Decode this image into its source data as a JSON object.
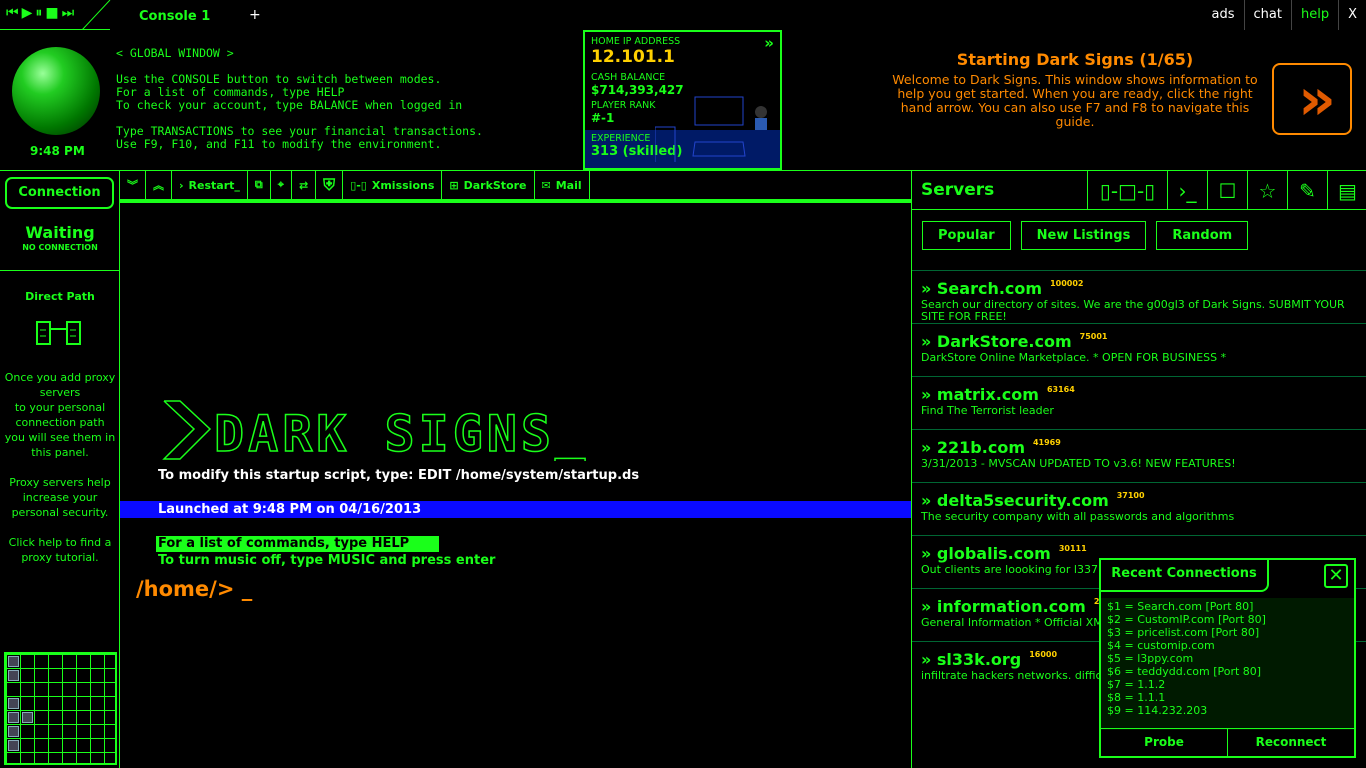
{
  "topbar": {
    "media_icons": [
      "skip-back-icon",
      "play-icon",
      "pause-icon",
      "stop-icon",
      "skip-forward-icon"
    ],
    "tab": "Console 1",
    "add_tab": "+",
    "links": [
      "ads",
      "chat",
      "help",
      "X"
    ]
  },
  "header": {
    "clock": "9:48 PM",
    "global_window": "< GLOBAL WINDOW >\n\nUse the CONSOLE button to switch between modes.\nFor a list of commands, type HELP\nTo check your account, type BALANCE when logged in\n\nType TRANSACTIONS to see your financial transactions.\nUse F9, F10, and F11 to modify the environment.",
    "stats": {
      "ip_label": "HOME IP ADDRESS",
      "ip": "12.101.1",
      "cash_label": "CASH BALANCE",
      "cash": "$714,393,427",
      "rank_label": "PLAYER RANK",
      "rank": "#-1",
      "exp_label": "EXPERIENCE",
      "exp": "313 (skilled)"
    },
    "guide": {
      "title": "Starting Dark Signs (1/65)",
      "text": "Welcome to Dark Signs. This window shows information to help you get started. When you are ready, click the right hand arrow. You can also use F7 and F8 to navigate this guide."
    }
  },
  "left": {
    "connection": "Connection",
    "status": "Waiting",
    "substatus": "NO CONNECTION",
    "path_title": "Direct Path",
    "help": "Once you add proxy servers\nto your personal connection path you will see them in this panel.\n\nProxy servers help increase your personal security.\n\nClick help to find a proxy tutorial."
  },
  "toolbar": {
    "restart": "Restart_",
    "xmissions": "Xmissions",
    "darkstore": "DarkStore",
    "mail": "Mail"
  },
  "console": {
    "logo": "DARK SIGNS_",
    "modify": "To modify this startup script, type: EDIT /home/system/startup.ds",
    "launched": "Launched at 9:48 PM on 04/16/2013",
    "help": "For a list of commands, type HELP",
    "music": "To turn music off, type MUSIC and press enter",
    "prompt": "/home/> _"
  },
  "servers": {
    "title": "Servers",
    "filters": [
      "Popular",
      "New Listings",
      "Random"
    ],
    "items": [
      {
        "name": "Search.com",
        "hits": "100002",
        "desc": "Search our directory of sites. We are the g00gl3 of Dark Signs. SUBMIT YOUR SITE FOR FREE!"
      },
      {
        "name": "DarkStore.com",
        "hits": "75001",
        "desc": "DarkStore Online Marketplace. * OPEN FOR BUSINESS *"
      },
      {
        "name": "matrix.com",
        "hits": "63164",
        "desc": "Find The Terrorist leader"
      },
      {
        "name": "221b.com",
        "hits": "41969",
        "desc": "3/31/2013 - MVSCAN UPDATED TO v3.6! NEW FEATURES!"
      },
      {
        "name": "delta5security.com",
        "hits": "37100",
        "desc": "The security company with all passwords and algorithms"
      },
      {
        "name": "globalis.com",
        "hits": "30111",
        "desc": "Out clients are loooking for l337 hackers. $$$"
      },
      {
        "name": "information.com",
        "hits": "2",
        "desc": "General Information * Official XM"
      },
      {
        "name": "sl33k.org",
        "hits": "16000",
        "desc": "infiltrate hackers networks. diffic... requires darksigns129 or later"
      }
    ]
  },
  "recent": {
    "title": "Recent Connections",
    "items": [
      "$1 = Search.com [Port 80]",
      "$2 = CustomIP.com [Port 80]",
      "$3 = pricelist.com [Port 80]",
      "$4 = customip.com",
      "$5 = l3ppy.com",
      "$6 = teddydd.com [Port 80]",
      "$7 = 1.1.2",
      "$8 = 1.1.1",
      "$9 = 114.232.203"
    ],
    "probe": "Probe",
    "reconnect": "Reconnect"
  },
  "colors": {
    "accent": "#1aff1a",
    "orange": "#ff8a00",
    "yellow": "#ffd000",
    "blue": "#0a0aff"
  }
}
